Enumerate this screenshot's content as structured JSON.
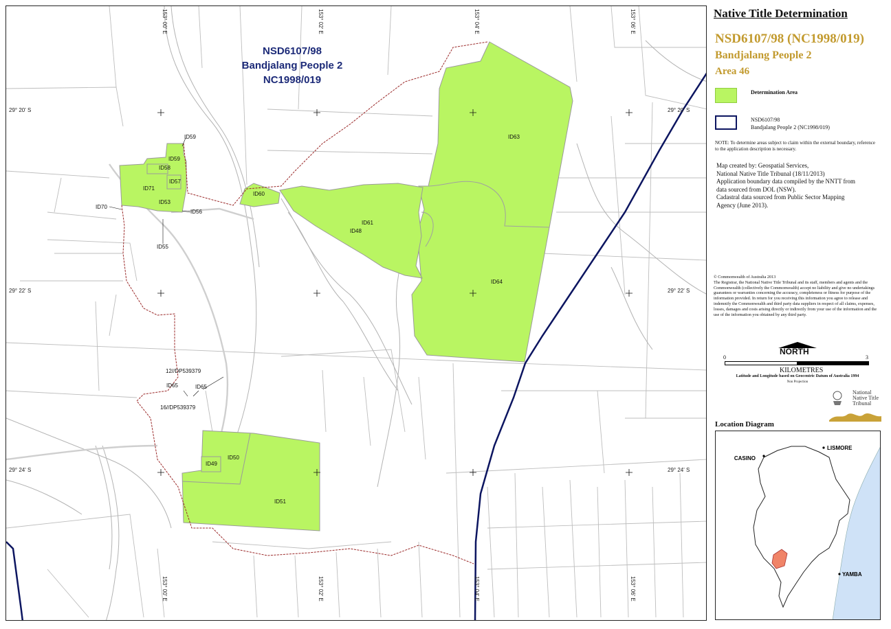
{
  "map": {
    "title_lines": [
      "NSD6107/98",
      "Bandjalang People 2",
      "NC1998/019"
    ],
    "longitudes_top": [
      "153° 00' E",
      "153° 02' E",
      "153° 04' E",
      "153° 06' E"
    ],
    "longitudes_bottom": [
      "153° 00' E",
      "153° 02' E",
      "153° 04' E",
      "153° 06' E"
    ],
    "latitudes_left": [
      "29° 20' S",
      "29° 22' S",
      "29° 24' S"
    ],
    "latitudes_right": [
      "29° 20' S",
      "29° 22' S",
      "29° 24' S"
    ],
    "labels": {
      "id59": "ID59",
      "id59b": "ID59",
      "id58": "ID58",
      "id57": "ID57",
      "id71": "ID71",
      "id53": "ID53",
      "id70": "ID70",
      "id56": "ID56",
      "id55": "ID55",
      "id60": "ID60",
      "id61": "ID61",
      "id48": "ID48",
      "id63": "ID63",
      "id64": "ID64",
      "lot12": "12//DP539379",
      "id65a": "ID65",
      "id65b": "ID65",
      "lot16": "16//DP539379",
      "id50": "ID50",
      "id49": "ID49",
      "id51": "ID51"
    },
    "colors": {
      "determination": "#b9f562",
      "boundary": "#0c1560",
      "ext_boundary": "#9b2a2a"
    }
  },
  "legend": {
    "title": "Native Title Determination",
    "application_number": "NSD6107/98 (NC1998/019)",
    "application_name": "Bandjalang People 2",
    "area": "Area 46",
    "determination_label": "Determination Area",
    "boundary_label_1": "NSD6107/98",
    "boundary_label_2": "Bandjalang People 2 (NC1998/019)",
    "note": "NOTE: To determine areas subject to claim within the external boundary, reference to the application description is necessary.",
    "credits": [
      "Map created by: Geospatial Services,",
      "National Native Title Tribunal   (18/11/2013)",
      "Application boundary data compiled by the NNTT from",
      "data sourced from DOL (NSW).",
      "Cadastral data sourced from Public Sector Mapping",
      "Agency (June 2013)."
    ],
    "copyright_head": "© Commonwealth of Australia 2013",
    "copyright_body": "The Registrar, the National Native Title Tribunal and its staff, members and agents and the Commonwealth (collectively the Commonwealth) accept no liability and give no undertakings guarantees or warranties concerning the accuracy, completeness or fitness for purpose of the information provided. In return for you receiving this information you agree to release and indemnify the Commonwealth and third party data suppliers in respect of all claims, expenses, losses, damages and costs arising directly or indirectly from your use of the information and the use of the information you obtained by any third party.",
    "north": "NORTH",
    "scale_start": "0",
    "scale_end": "3",
    "scale_units": "KILOMETRES",
    "datum": "Latitude and Longitude based on Geocentric Datum of Australia 1994",
    "projection": "Non Projection",
    "logo_text": [
      "National",
      "Native Title",
      "Tribunal"
    ],
    "location_title": "Location Diagram",
    "towns": [
      "CASINO",
      "LISMORE",
      "YAMBA"
    ]
  }
}
